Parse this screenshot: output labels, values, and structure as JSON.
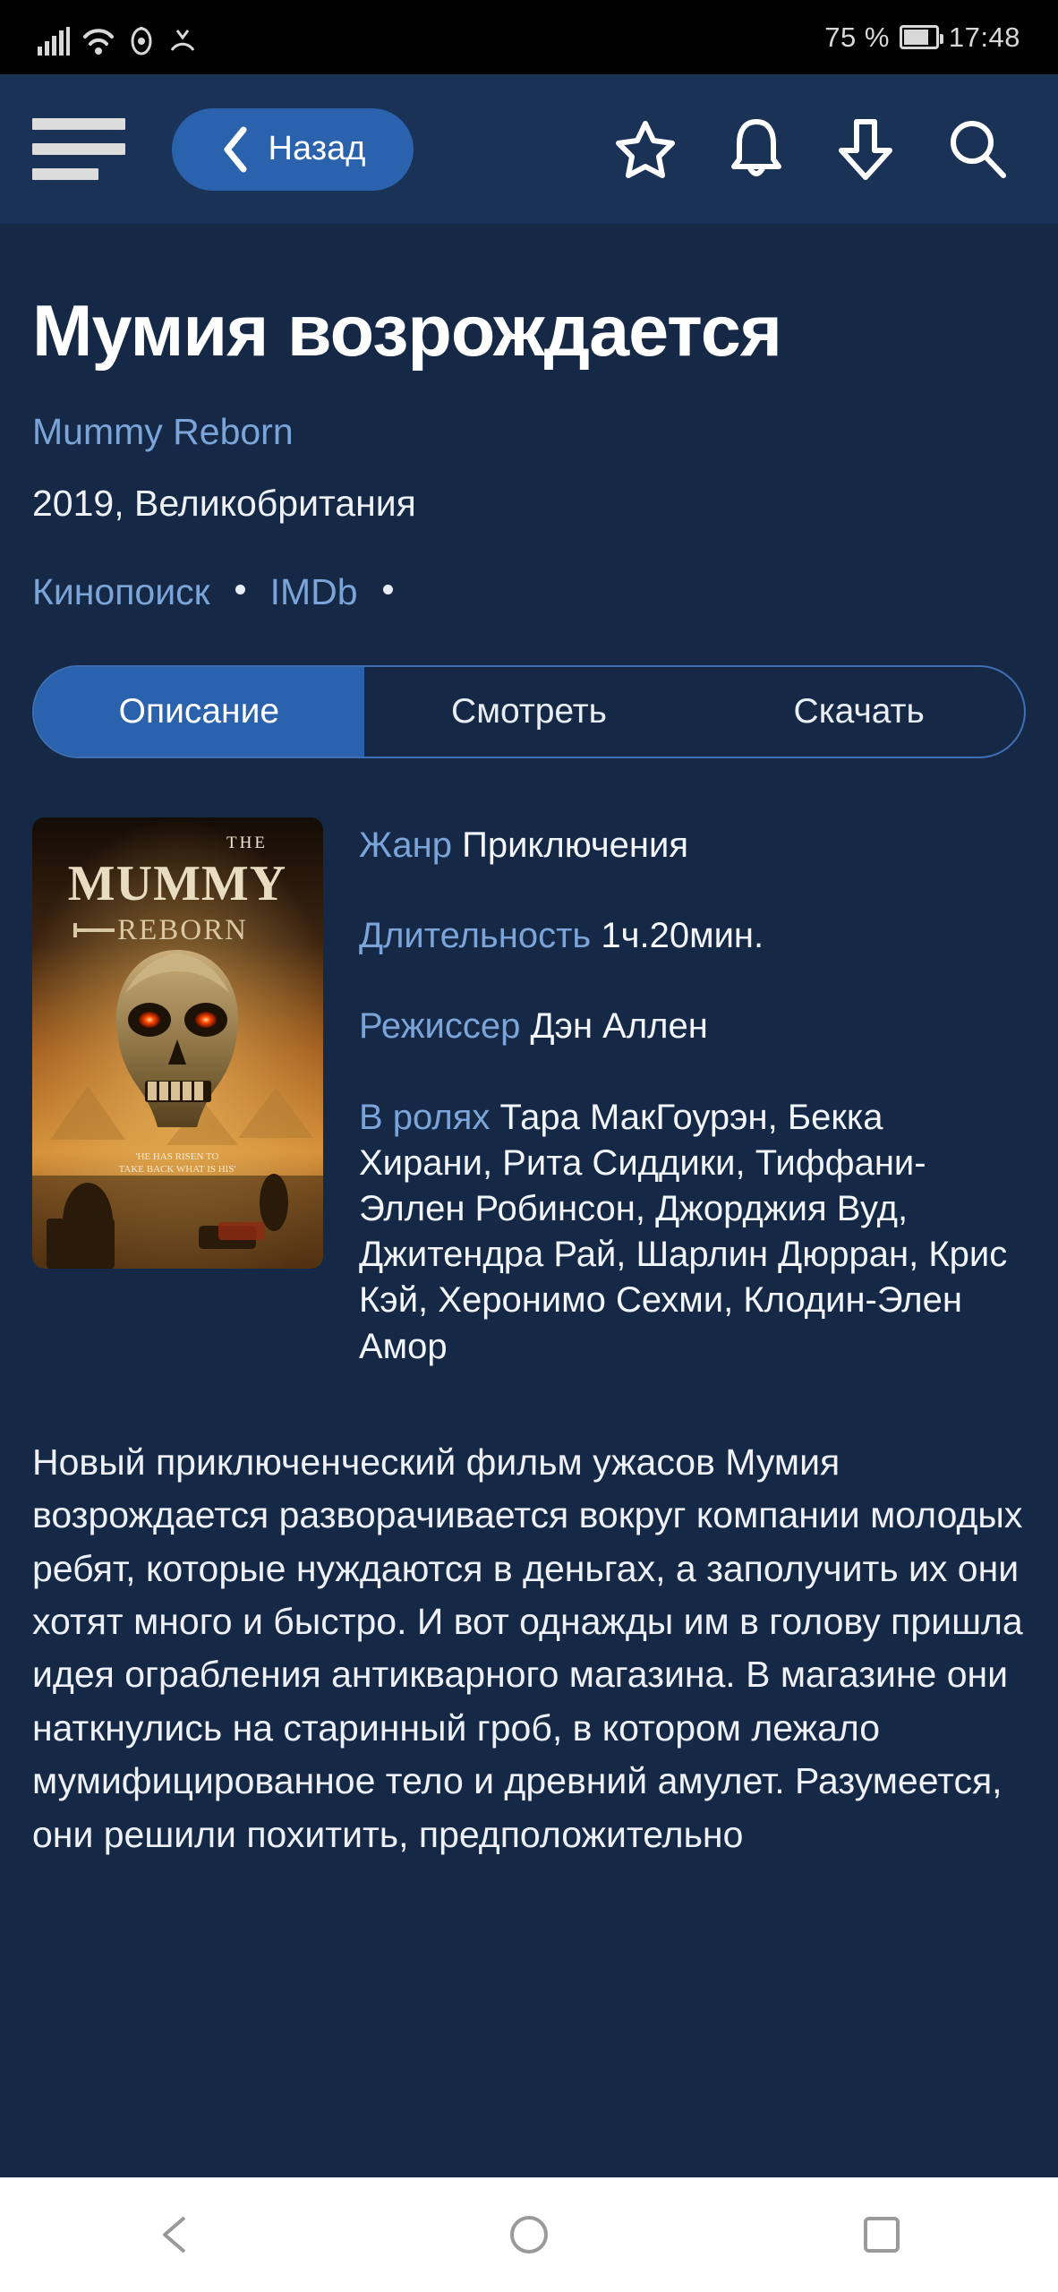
{
  "status_bar": {
    "battery_percent": "75 %",
    "time": "17:48",
    "icons": [
      "signal-icon",
      "wifi-icon",
      "eye-icon",
      "mute-icon",
      "battery-icon"
    ]
  },
  "app_bar": {
    "menu_icon": "hamburger-menu-icon",
    "back_label": "Назад",
    "back_icon": "chevron-left-icon",
    "actions": [
      {
        "name": "star-icon",
        "label": "Избранное"
      },
      {
        "name": "bell-icon",
        "label": "Уведомления"
      },
      {
        "name": "download-icon",
        "label": "Загрузки"
      },
      {
        "name": "search-icon",
        "label": "Поиск"
      }
    ]
  },
  "movie": {
    "title": "Мумия возрождается",
    "original_title": "Mummy Reborn",
    "year_country": "2019, Великобритания",
    "ratings": [
      {
        "source": "Кинопоиск",
        "value": "."
      },
      {
        "source": "IMDb",
        "value": "."
      }
    ],
    "poster": {
      "alt": "Постер фильма Мумия возрождается",
      "line1": "THE",
      "line2": "MUMMY",
      "line3": "REBORN",
      "tagline1": "'HE HAS RISEN TO",
      "tagline2": "TAKE BACK WHAT IS HIS'"
    },
    "meta": [
      {
        "key": "Жанр",
        "value": "Приключения"
      },
      {
        "key": "Длительность",
        "value": "1ч.20мин."
      },
      {
        "key": "Режиссер",
        "value": "Дэн Аллен"
      },
      {
        "key": "В ролях",
        "value": "Тара МакГоурэн, Бекка Хирани, Рита Сиддики, Тиффани-Эллен Робинсон, Джорджия Вуд, Джитендра Рай, Шарлин Дюрран, Крис Кэй, Херонимо Сехми, Клодин-Элен Амор"
      }
    ],
    "description": "Новый приключенческий фильм ужасов Мумия возрождается разворачивается вокруг компании молодых ребят, которые нуждаются в деньгах, а заполучить их они хотят много и быстро. И вот однажды им в голову пришла идея ограбления антикварного магазина. В магазине они наткнулись на старинный гроб, в котором лежало мумифицированное тело и древний амулет. Разумеется, они решили похитить, предположительно"
  },
  "tabs": [
    {
      "label": "Описание",
      "active": true
    },
    {
      "label": "Смотреть",
      "active": false
    },
    {
      "label": "Скачать",
      "active": false
    }
  ],
  "nav_bar": {
    "back_icon": "nav-back-triangle-icon",
    "home_icon": "nav-home-circle-icon",
    "recents_icon": "nav-recents-square-icon"
  },
  "colors": {
    "header_bg": "#1b3257",
    "page_bg": "#152846",
    "accent": "#2a62ad",
    "link": "#7ba4d8"
  }
}
